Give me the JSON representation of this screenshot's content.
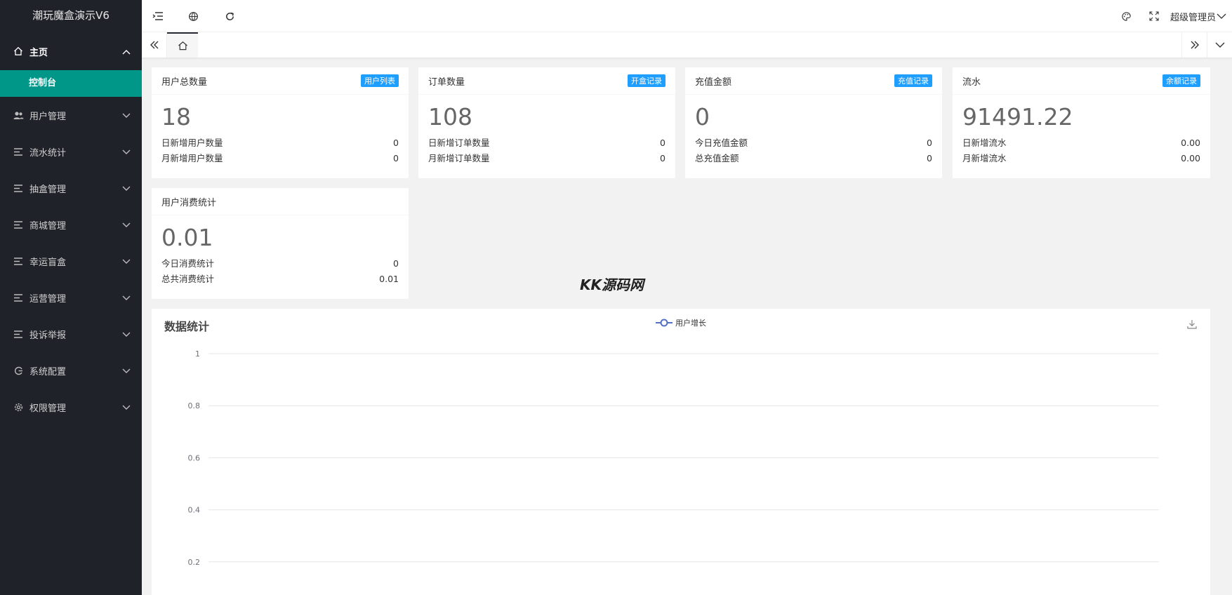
{
  "app": {
    "title": "潮玩魔盒演示V6"
  },
  "sidebar": {
    "home": {
      "label": "主页",
      "icon": "home-icon"
    },
    "home_sub": {
      "label": "控制台"
    },
    "items": [
      {
        "label": "用户管理",
        "icon": "users-icon"
      },
      {
        "label": "流水统计",
        "icon": "list-icon"
      },
      {
        "label": "抽盒管理",
        "icon": "list-icon"
      },
      {
        "label": "商城管理",
        "icon": "list-icon"
      },
      {
        "label": "幸运盲盒",
        "icon": "list-icon"
      },
      {
        "label": "运营管理",
        "icon": "list-icon"
      },
      {
        "label": "投诉举报",
        "icon": "list-icon"
      },
      {
        "label": "系统配置",
        "icon": "cog-circle-icon"
      },
      {
        "label": "权限管理",
        "icon": "gear-icon"
      }
    ]
  },
  "header": {
    "user": "超级管理员"
  },
  "cards": [
    {
      "title": "用户总数量",
      "badge": "用户列表",
      "value": "18",
      "rows": [
        {
          "label": "日新增用户数量",
          "value": "0"
        },
        {
          "label": "月新增用户数量",
          "value": "0"
        }
      ]
    },
    {
      "title": "订单数量",
      "badge": "开盒记录",
      "value": "108",
      "rows": [
        {
          "label": "日新增订单数量",
          "value": "0"
        },
        {
          "label": "月新增订单数量",
          "value": "0"
        }
      ]
    },
    {
      "title": "充值金额",
      "badge": "充值记录",
      "value": "0",
      "rows": [
        {
          "label": "今日充值金额",
          "value": "0"
        },
        {
          "label": "总充值金额",
          "value": "0"
        }
      ]
    },
    {
      "title": "流水",
      "badge": "余额记录",
      "value": "91491.22",
      "rows": [
        {
          "label": "日新增流水",
          "value": "0.00"
        },
        {
          "label": "月新增流水",
          "value": "0.00"
        }
      ]
    },
    {
      "title": "用户消费统计",
      "value": "0.01",
      "rows": [
        {
          "label": "今日消费统计",
          "value": "0"
        },
        {
          "label": "总共消费统计",
          "value": "0.01"
        }
      ]
    }
  ],
  "watermark": "KK源码网",
  "colors": {
    "sidebar_bg": "#20222a",
    "active": "#009688",
    "badge": "#1e9fff",
    "series": "#5470c6"
  },
  "chart_data": {
    "type": "line",
    "title": "数据统计",
    "series": [
      {
        "name": "用户增长",
        "values": []
      }
    ],
    "y_ticks": [
      "1",
      "0.8",
      "0.6",
      "0.4",
      "0.2"
    ],
    "ylim": [
      0,
      1
    ],
    "grid": true,
    "legend": "top-center"
  }
}
